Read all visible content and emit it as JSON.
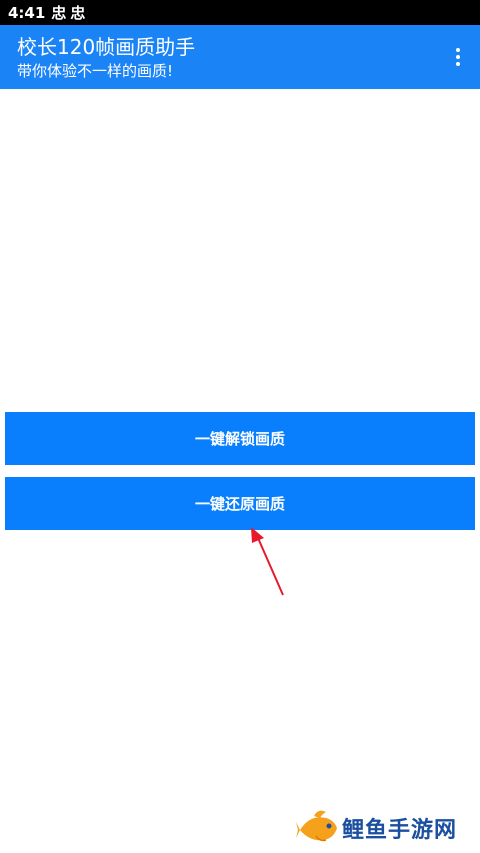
{
  "status_bar": {
    "time": "4:41",
    "icons": [
      "bug-icon",
      "bug-icon"
    ],
    "icon_glyph": "忠"
  },
  "app_bar": {
    "title": "校长120帧画质助手",
    "subtitle": "带你体验不一样的画质!",
    "menu_icon": "more-vert-icon",
    "color": "#1a83f6"
  },
  "buttons": {
    "unlock_label": "一键解锁画质",
    "restore_label": "一键还原画质",
    "color": "#0a7ffe"
  },
  "annotation": {
    "arrow_color": "#e8192c",
    "target": "restore_button"
  },
  "watermark": {
    "text": "鲤鱼手游网",
    "logo_icon": "carp-fish-icon"
  }
}
